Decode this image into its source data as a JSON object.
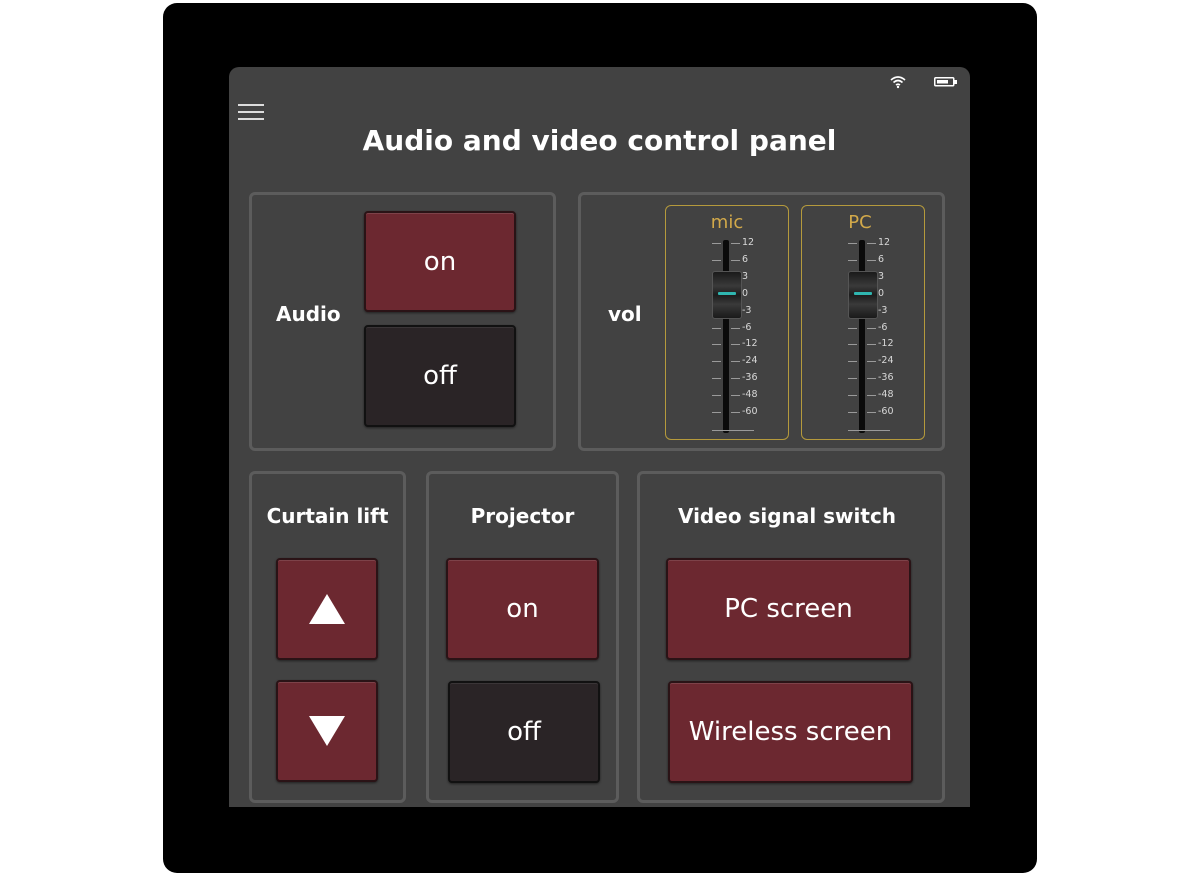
{
  "header": {
    "title": "Audio and video control panel",
    "menu_icon": "hamburger-menu-icon",
    "status_icons": [
      "wifi-icon",
      "battery-icon"
    ]
  },
  "audio": {
    "label": "Audio",
    "on_label": "on",
    "off_label": "off"
  },
  "volume": {
    "label": "vol",
    "scale": [
      "12",
      "6",
      "3",
      "0",
      "-3",
      "-6",
      "-12",
      "-24",
      "-36",
      "-48",
      "-60"
    ],
    "channels": [
      {
        "name": "mic",
        "value_db": 0
      },
      {
        "name": "PC",
        "value_db": 0
      }
    ]
  },
  "curtain": {
    "label": "Curtain lift",
    "up_icon": "arrow-up-icon",
    "down_icon": "arrow-down-icon"
  },
  "projector": {
    "label": "Projector",
    "on_label": "on",
    "off_label": "off"
  },
  "video": {
    "label": "Video signal switch",
    "pc_label": "PC screen",
    "wireless_label": "Wireless screen"
  },
  "colors": {
    "accent_red": "#6c2830",
    "off_dark": "#2a2426",
    "fader_gold": "#d2a94a",
    "screen_bg": "#424242",
    "fader_led": "#2fb6b0"
  }
}
